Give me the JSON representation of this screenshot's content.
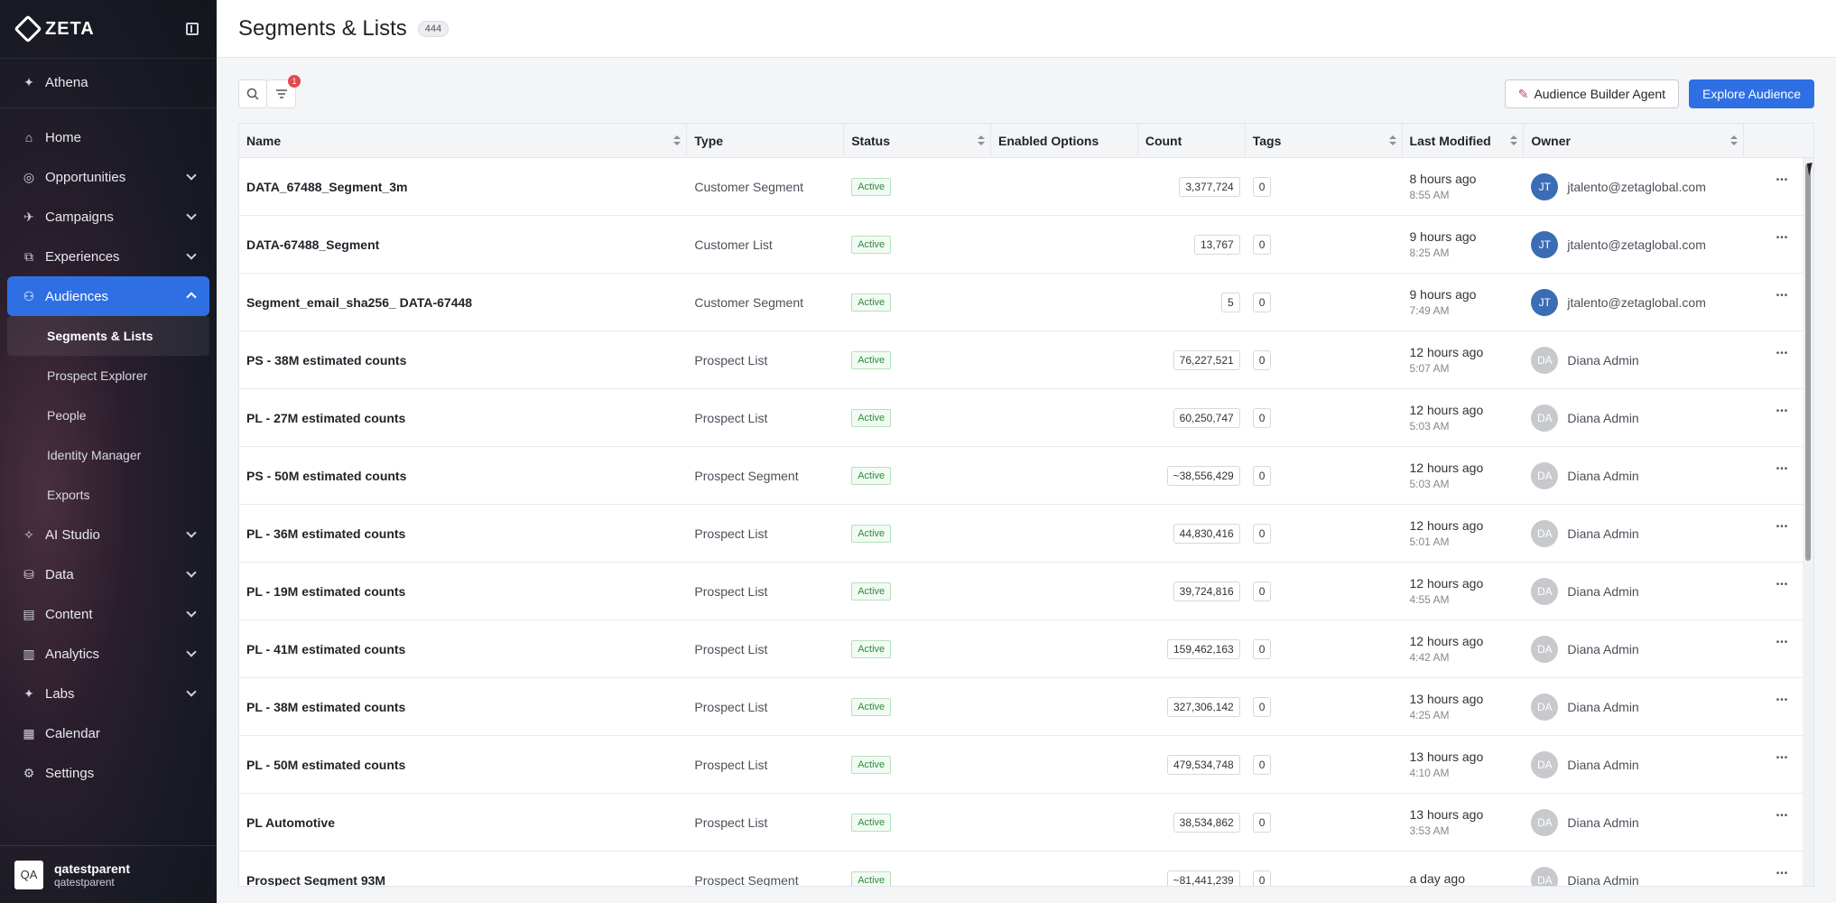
{
  "brand": {
    "name": "ZETA"
  },
  "sidebar": {
    "top_item": {
      "label": "Athena",
      "icon": "sparkle-icon"
    },
    "items": [
      {
        "label": "Home",
        "icon": "home-icon",
        "expandable": false
      },
      {
        "label": "Opportunities",
        "icon": "target-icon",
        "expandable": true
      },
      {
        "label": "Campaigns",
        "icon": "megaphone-icon",
        "expandable": true
      },
      {
        "label": "Experiences",
        "icon": "flow-icon",
        "expandable": true
      },
      {
        "label": "Audiences",
        "icon": "users-icon",
        "expandable": true,
        "active": true
      }
    ],
    "audience_sub": [
      {
        "label": "Segments & Lists",
        "current": true
      },
      {
        "label": "Prospect Explorer"
      },
      {
        "label": "People"
      },
      {
        "label": "Identity Manager"
      },
      {
        "label": "Exports"
      }
    ],
    "items_after": [
      {
        "label": "AI Studio",
        "icon": "ai-icon",
        "expandable": true
      },
      {
        "label": "Data",
        "icon": "database-icon",
        "expandable": true
      },
      {
        "label": "Content",
        "icon": "content-icon",
        "expandable": true
      },
      {
        "label": "Analytics",
        "icon": "analytics-icon",
        "expandable": true
      },
      {
        "label": "Labs",
        "icon": "labs-icon",
        "expandable": true
      },
      {
        "label": "Calendar",
        "icon": "calendar-icon",
        "expandable": false
      },
      {
        "label": "Settings",
        "icon": "gear-icon",
        "expandable": false
      }
    ],
    "account": {
      "initials": "QA",
      "name": "qatestparent",
      "sub": "qatestparent"
    }
  },
  "header": {
    "title": "Segments & Lists",
    "count": "444"
  },
  "toolbar": {
    "filter_count": "1",
    "agent_label": "Audience Builder Agent",
    "explore_label": "Explore Audience"
  },
  "table": {
    "columns": [
      "Name",
      "Type",
      "Status",
      "Enabled Options",
      "Count",
      "Tags",
      "Last Modified",
      "Owner"
    ],
    "rows": [
      {
        "name": "DATA_67488_Segment_3m",
        "type": "Customer Segment",
        "status": "Active",
        "count": "3,377,724",
        "tags": "0",
        "modified": "8 hours ago",
        "time": "8:55 AM",
        "owner_initials": "JT",
        "owner": "jtalento@zetaglobal.com",
        "av": "blue"
      },
      {
        "name": "DATA-67488_Segment",
        "type": "Customer List",
        "status": "Active",
        "count": "13,767",
        "tags": "0",
        "modified": "9 hours ago",
        "time": "8:25 AM",
        "owner_initials": "JT",
        "owner": "jtalento@zetaglobal.com",
        "av": "blue"
      },
      {
        "name": "Segment_email_sha256_ DATA-67448",
        "type": "Customer Segment",
        "status": "Active",
        "count": "5",
        "tags": "0",
        "modified": "9 hours ago",
        "time": "7:49 AM",
        "owner_initials": "JT",
        "owner": "jtalento@zetaglobal.com",
        "av": "blue"
      },
      {
        "name": "PS - 38M estimated counts",
        "type": "Prospect List",
        "status": "Active",
        "count": "76,227,521",
        "tags": "0",
        "modified": "12 hours ago",
        "time": "5:07 AM",
        "owner_initials": "DA",
        "owner": "Diana Admin",
        "av": "grey"
      },
      {
        "name": "PL - 27M estimated counts",
        "type": "Prospect List",
        "status": "Active",
        "count": "60,250,747",
        "tags": "0",
        "modified": "12 hours ago",
        "time": "5:03 AM",
        "owner_initials": "DA",
        "owner": "Diana Admin",
        "av": "grey"
      },
      {
        "name": "PS - 50M estimated counts",
        "type": "Prospect Segment",
        "status": "Active",
        "count": "~38,556,429",
        "tags": "0",
        "modified": "12 hours ago",
        "time": "5:03 AM",
        "owner_initials": "DA",
        "owner": "Diana Admin",
        "av": "grey"
      },
      {
        "name": "PL - 36M estimated counts",
        "type": "Prospect List",
        "status": "Active",
        "count": "44,830,416",
        "tags": "0",
        "modified": "12 hours ago",
        "time": "5:01 AM",
        "owner_initials": "DA",
        "owner": "Diana Admin",
        "av": "grey"
      },
      {
        "name": "PL - 19M estimated counts",
        "type": "Prospect List",
        "status": "Active",
        "count": "39,724,816",
        "tags": "0",
        "modified": "12 hours ago",
        "time": "4:55 AM",
        "owner_initials": "DA",
        "owner": "Diana Admin",
        "av": "grey"
      },
      {
        "name": "PL - 41M estimated counts",
        "type": "Prospect List",
        "status": "Active",
        "count": "159,462,163",
        "tags": "0",
        "modified": "12 hours ago",
        "time": "4:42 AM",
        "owner_initials": "DA",
        "owner": "Diana Admin",
        "av": "grey"
      },
      {
        "name": "PL - 38M estimated counts",
        "type": "Prospect List",
        "status": "Active",
        "count": "327,306,142",
        "tags": "0",
        "modified": "13 hours ago",
        "time": "4:25 AM",
        "owner_initials": "DA",
        "owner": "Diana Admin",
        "av": "grey"
      },
      {
        "name": "PL - 50M estimated counts",
        "type": "Prospect List",
        "status": "Active",
        "count": "479,534,748",
        "tags": "0",
        "modified": "13 hours ago",
        "time": "4:10 AM",
        "owner_initials": "DA",
        "owner": "Diana Admin",
        "av": "grey"
      },
      {
        "name": "PL Automotive",
        "type": "Prospect List",
        "status": "Active",
        "count": "38,534,862",
        "tags": "0",
        "modified": "13 hours ago",
        "time": "3:53 AM",
        "owner_initials": "DA",
        "owner": "Diana Admin",
        "av": "grey"
      },
      {
        "name": "Prospect Segment 93M",
        "type": "Prospect Segment",
        "status": "Active",
        "count": "~81,441,239",
        "tags": "0",
        "modified": "a day ago",
        "time": "",
        "owner_initials": "DA",
        "owner": "Diana Admin",
        "av": "grey"
      }
    ]
  }
}
